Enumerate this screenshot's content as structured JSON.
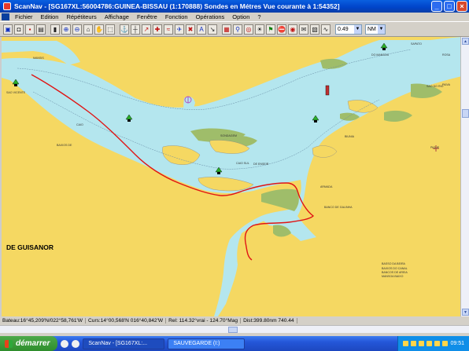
{
  "window": {
    "title": "ScanNav - [SG167XL:56004786:GUINEA-BISSAU (1:170888)   Sondes en  Métres    Vue courante à 1:54352]"
  },
  "menu": {
    "items": [
      "Fichier",
      "Edition",
      "Répétiteurs",
      "Affichage",
      "Fenêtre",
      "Fonction",
      "Opérations",
      "Option",
      "?"
    ]
  },
  "toolbar": {
    "scale_value": "0.49",
    "unit_value": "NM"
  },
  "map": {
    "labels": {
      "guisanor": "DE GUISANOR",
      "guisanor_note_1": "BAIXOS DO CANAL",
      "guisanor_note_2": "BANCOS DE AREIA",
      "l1": "MANSIS",
      "l2": "BAIXOS DE",
      "l3": "CAIO",
      "l4": "SAO VICENTE",
      "l5": "DO MANSOA",
      "l6": "SAPATO",
      "l7": "BIUNIA",
      "l8": "BANCO DE GALINHA",
      "l9": "ARMADA",
      "l10": "CAIO SUL",
      "l11": "DE ENSEIR",
      "l12": "SONDAGEM",
      "l13": "SAO DO RIO",
      "l14": "PAIVA",
      "l15": "PIQUE",
      "l16": "BASSO DA BEIRA",
      "l17": "MANSOA BAIXO",
      "l18": "ROSA"
    },
    "colors": {
      "land": "#f5d862",
      "shallow": "#b4e6ee",
      "drying": "#9fbd6a",
      "track": "#e01414"
    }
  },
  "status": {
    "bateau": "Bateau:16°45,209'N/022°58,761'W",
    "curseur": "Curs:14°00,568'N 016°40,842'W",
    "rel": "Rel: 114.32°vrai - 124.70°Mag",
    "dist": "Dist:399.80nm  740.44"
  },
  "taskbar": {
    "start": "démarrer",
    "task1": "ScanNav - [SG167XL:...",
    "task2": "SAUVEGARDE (I:)",
    "clock": "09:51"
  }
}
